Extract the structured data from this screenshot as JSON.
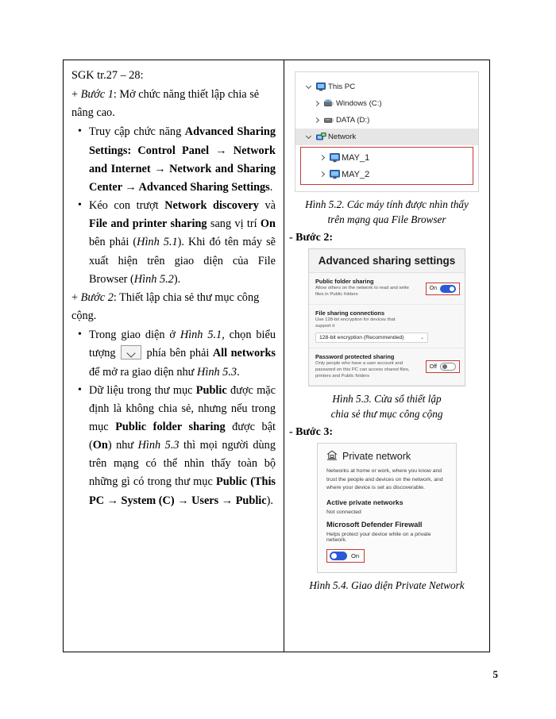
{
  "page": {
    "number": "5"
  },
  "left_column": {
    "intro": "SGK tr.27 – 28:",
    "step1_prefix": "+ ",
    "step1_italic": "Bước 1",
    "step1_rest": ": Mở chức năng thiết lập chia sẻ nâng cao.",
    "bullet1": {
      "p1": "Truy cập chức năng ",
      "b1": "Advanced Sharing Settings: Control Panel",
      "a1": " → ",
      "b2": "Network and Internet",
      "a2": " → ",
      "b3": "Network and Sharing Center",
      "a3": " → ",
      "b4": "Advanced Sharing Settings",
      "p2": "."
    },
    "bullet2": {
      "p1": "Kéo con trượt ",
      "b1": "Network discovery",
      "p2": " và ",
      "b2": "File and printer sharing",
      "p3": " sang vị trí ",
      "b3": "On",
      "p4": " bên phải (",
      "i1": "Hình 5.1",
      "p5": "). Khi đó tên máy sẽ xuất hiện trên giao diện của File Browser (",
      "i2": "Hình 5.2",
      "p6": ")."
    },
    "step2_prefix": "+ ",
    "step2_italic": "Bước 2",
    "step2_rest": ": Thiết lập chia sẻ thư mục công cộng.",
    "bullet3": {
      "p1": "Trong giao diện ở ",
      "i1": "Hình 5.1",
      "p2": ", chọn biểu tượng ",
      "icon": "chevron-down-icon",
      "p3": " phía bên phải ",
      "b1": "All networks",
      "p4": " để mở ra giao diện như ",
      "i2": "Hình 5.3",
      "p5": "."
    },
    "bullet4": {
      "p1": "Dữ liệu trong thư mục ",
      "b1": "Public",
      "p2": " được mặc định là không chia sẻ, nhưng nếu trong mục ",
      "b2": "Public folder sharing",
      "p3": " được bật (",
      "b3": "On",
      "p4": ") như ",
      "i1": "Hình 5.3",
      "p5": " thì mọi người dùng trên mạng có thể nhìn thấy toàn bộ những gì có trong thư mục ",
      "b4": "Public (This PC",
      "a1": " → ",
      "b5": "System (C)",
      "a2": " → ",
      "b6": "Users",
      "a3": " → ",
      "b7": "Public",
      "p6": ")."
    }
  },
  "right_column": {
    "fig52": {
      "tree": [
        {
          "expander": "chevron-down",
          "icon": "monitor-icon",
          "label": "This PC",
          "indent": 0,
          "selected": false,
          "boxed": false,
          "big": false
        },
        {
          "expander": "chevron-right",
          "icon": "drive-windows-icon",
          "label": "Windows (C:)",
          "indent": 1,
          "selected": false,
          "boxed": false,
          "big": false
        },
        {
          "expander": "chevron-right",
          "icon": "drive-icon",
          "label": "DATA (D:)",
          "indent": 1,
          "selected": false,
          "boxed": false,
          "big": false
        },
        {
          "expander": "chevron-down",
          "icon": "network-icon",
          "label": "Network",
          "indent": 0,
          "selected": true,
          "boxed": false,
          "big": false
        },
        {
          "expander": "chevron-right",
          "icon": "monitor-icon",
          "label": "MAY_1",
          "indent": 1,
          "selected": false,
          "boxed": true,
          "big": true
        },
        {
          "expander": "chevron-right",
          "icon": "monitor-icon",
          "label": "MAY_2",
          "indent": 1,
          "selected": false,
          "boxed": true,
          "big": true
        }
      ],
      "caption_line1": "Hình 5.2. Các máy tính được nhìn thấy",
      "caption_line2": "trên mạng qua File Browser"
    },
    "step2_label": "- Bước 2:",
    "fig53": {
      "title": "Advanced sharing settings",
      "sections": [
        {
          "heading": "Public folder sharing",
          "desc": "Allow others on the network to  read and write files in Public folders",
          "toggle_label": "On",
          "toggle_state": "on"
        },
        {
          "heading": "File sharing connections",
          "desc": "Use 128-bit encryption for devices that support it",
          "select_value": "128-bit encryption (Recommended)"
        },
        {
          "heading": "Password protected sharing",
          "desc": "Only people who have a user account and password on this  PC can access shared files, printers and Public folders",
          "toggle_label": "Off",
          "toggle_state": "off"
        }
      ],
      "caption_line1": "Hình 5.3. Cửa sổ thiết lập",
      "caption_line2": "chia sẻ thư mục công cộng"
    },
    "step3_label": "- Bước 3:",
    "fig54": {
      "icon": "private-network-icon",
      "title": "Private network",
      "desc": "Networks at home or work, where you know and trust the people and devices on the network, and where your device is set as discoverable.",
      "section1_heading": "Active private networks",
      "section1_value": "Not connected",
      "section2_heading": "Microsoft Defender Firewall",
      "section2_desc": "Helps protect your device while on a private network.",
      "toggle_label": "On",
      "toggle_state": "on",
      "caption": "Hình 5.4. Giao diện Private Network"
    }
  },
  "colors": {
    "red_highlight": "#c63a34",
    "toggle_on": "#2a5bd7",
    "selection": "#e6e6e6",
    "icon_blue": "#2a6fc4"
  }
}
